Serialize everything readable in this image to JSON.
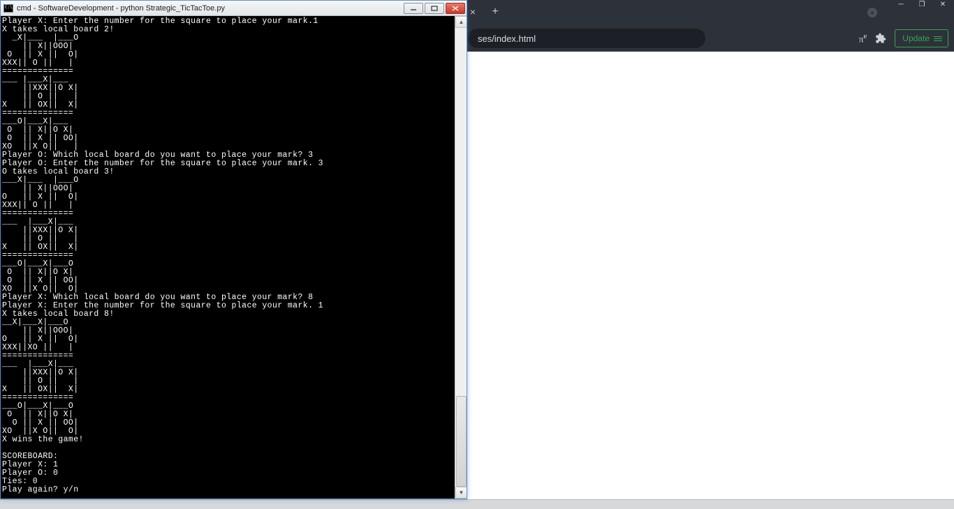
{
  "os_window_controls": {
    "min": "─",
    "max": "❐",
    "close": "✕"
  },
  "browser": {
    "address_fragment": "ses/index.html",
    "update_label": "Update",
    "tab_close": "×",
    "tab_new": "+"
  },
  "cmd": {
    "title": "cmd - SoftwareDevelopment - python  Strategic_TicTacToe.py",
    "lines": [
      "Player X: Enter the number for the square to place your mark.1",
      "X takes local board 2!",
      "  _X|___  |___O",
      "    || X||OOO|",
      " O  || X ||  O|",
      "XXX|| O ||   |",
      "==============",
      "___ |___X|___",
      "    ||XXX||O X|",
      "    || O ||   |",
      "X   || OX||  X|",
      "==============",
      "___O|___X|___",
      " O  || X||O X|",
      " O  || X || OO|",
      "XO  ||X O||   |",
      "Player O: Which local board do you want to place your mark? 3",
      "Player O: Enter the number for the square to place your mark. 3",
      "O takes local board 3!",
      "___X|___  |___O",
      "    || X||OOO|",
      "O   || X ||  O|",
      "XXX|| O ||   |",
      "==============",
      "___  |___X|___",
      "    ||XXX||O X|",
      "    || O ||   |",
      "X   || OX||  X|",
      "==============",
      "___O|___X|___O",
      " O  || X||O X|",
      " O  || X || OO|",
      "XO  ||X O||  O|",
      "Player X: Which local board do you want to place your mark? 8",
      "Player X: Enter the number for the square to place your mark. 1",
      "X takes local board 8!",
      "__X|___X|___O",
      "    || X||OOO|",
      "O   || X ||  O|",
      "XXX||XO ||   |",
      "==============",
      "___  |___X|___",
      "    ||XXX||O X|",
      "    || O ||   |",
      "X   || OX||  X|",
      "==============",
      "___O|___X|___O",
      " O  || X||O X|",
      "  O || X || OO|",
      "XO  ||X O||  O|",
      "X wins the game!",
      "",
      "SCOREBOARD:",
      "Player X: 1",
      "Player O: 0",
      "Ties: 0",
      "Play again? y/n"
    ]
  }
}
